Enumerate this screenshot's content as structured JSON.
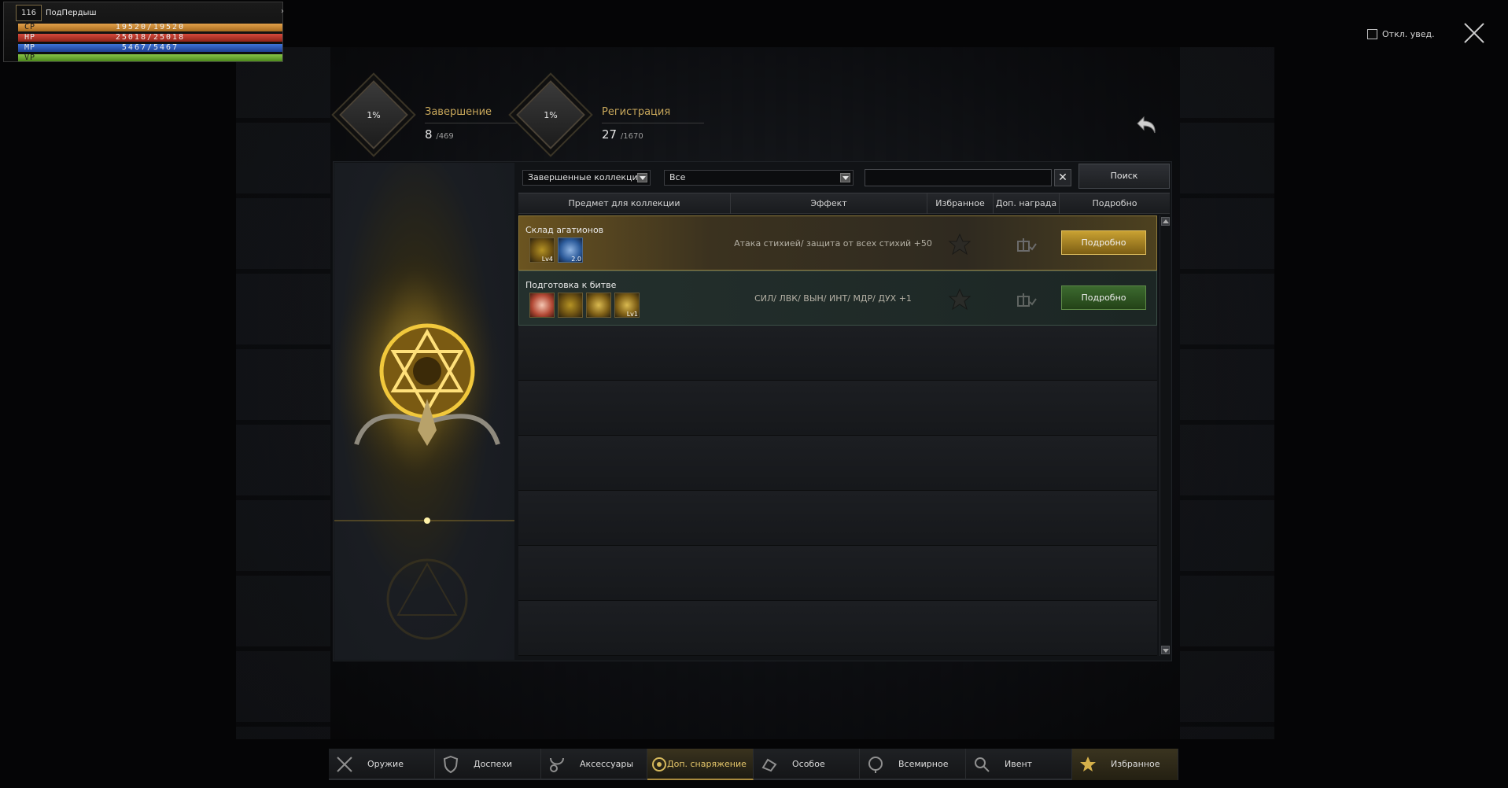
{
  "player": {
    "level": "116",
    "name": "ПодПердыш",
    "bars": [
      {
        "tag": "CP",
        "value": "19520/19520",
        "fill": 1.0
      },
      {
        "tag": "HP",
        "value": "25018/25018",
        "fill": 1.0
      },
      {
        "tag": "MP",
        "value": "5467/5467",
        "fill": 1.0
      },
      {
        "tag": "VP",
        "value": "",
        "fill": 1.0
      }
    ]
  },
  "top": {
    "mute_label": "Откл. увед.",
    "close_icon": "close-icon"
  },
  "progress": [
    {
      "percent": "1%",
      "title": "Завершение",
      "count": "8",
      "total": "/469"
    },
    {
      "percent": "1%",
      "title": "Регистрация",
      "count": "27",
      "total": "/1670"
    }
  ],
  "filters": {
    "collection_filter": "Завершенные коллекции",
    "type_filter": "Все",
    "search_value": "",
    "search_button": "Поиск",
    "clear_button": "✕"
  },
  "table": {
    "columns": [
      "Предмет для коллекции",
      "Эффект",
      "Избранное",
      "Доп. награда",
      "Подробно"
    ],
    "rows": [
      {
        "name": "Склад агатионов",
        "items": [
          {
            "icon": "agathion-gold-icon",
            "badge": "Lv4"
          },
          {
            "icon": "gear-blue-icon",
            "badge": "2.0"
          }
        ],
        "effect": "Атака стихией/ защита от всех стихий +50",
        "detail_button": "Подробно"
      },
      {
        "name": "Подготовка к битве",
        "items": [
          {
            "icon": "potion-icon",
            "badge": ""
          },
          {
            "icon": "agathion-gold-icon",
            "badge": ""
          },
          {
            "icon": "weapon-scroll-icon",
            "badge": ""
          },
          {
            "icon": "spellbook-icon",
            "badge": "Lv1"
          }
        ],
        "effect": "СИЛ/ ЛВК/ ВЫН/ ИНТ/ МДР/ ДУХ +1",
        "detail_button": "Подробно"
      }
    ]
  },
  "tabs": [
    {
      "label": "Оружие",
      "icon": "sword-icon",
      "active": false
    },
    {
      "label": "Доспехи",
      "icon": "shield-icon",
      "active": false
    },
    {
      "label": "Аксессуары",
      "icon": "necklace-icon",
      "active": false
    },
    {
      "label": "Доп. снаряжение",
      "icon": "agathion-icon",
      "active": true
    },
    {
      "label": "Особое",
      "icon": "special-icon",
      "active": false
    },
    {
      "label": "Всемирное",
      "icon": "globe-icon",
      "active": false
    },
    {
      "label": "Ивент",
      "icon": "event-icon",
      "active": false
    },
    {
      "label": "Избранное",
      "icon": "star-icon",
      "active": false
    }
  ],
  "colors": {
    "accent_gold": "#c9a85b",
    "detail_gold": "#c9a132",
    "detail_green": "#3c6a2f"
  }
}
